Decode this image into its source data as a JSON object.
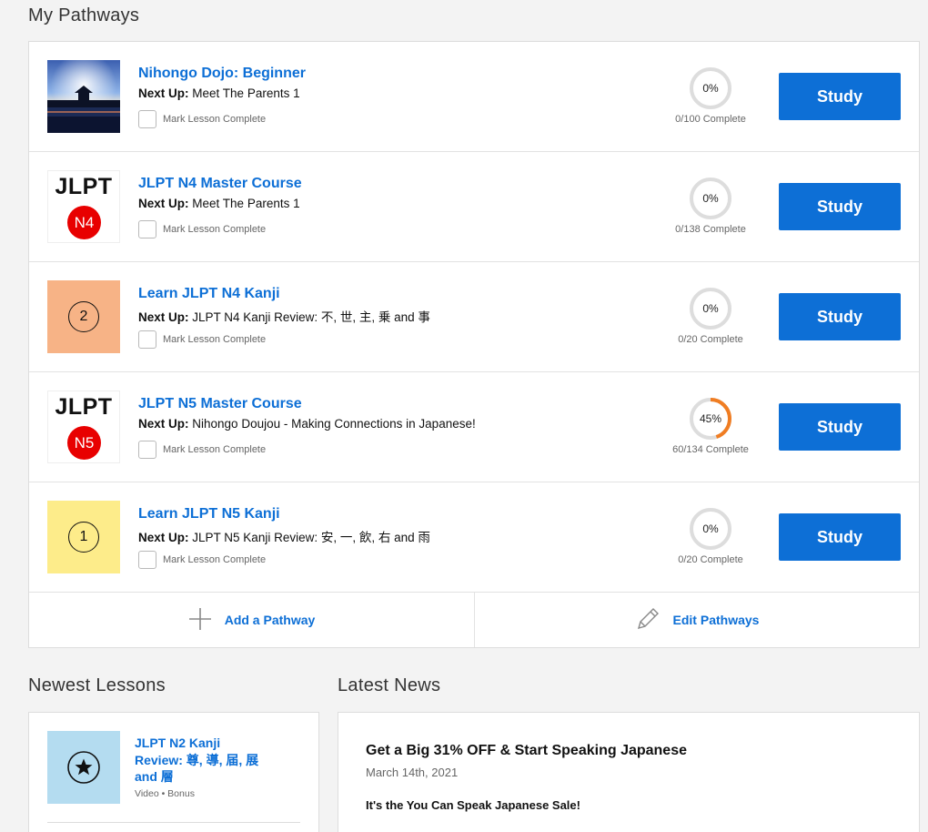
{
  "sections": {
    "pathways_title": "My Pathways",
    "newest_lessons_title": "Newest Lessons",
    "latest_news_title": "Latest News"
  },
  "colors": {
    "accent": "#0d6fd6",
    "progress_track": "#dddddd",
    "progress_fill": "#f07d22",
    "n4_kanji_tile": "#f7b386",
    "n5_kanji_tile": "#fdec8a",
    "lesson_tile": "#b4dcf0",
    "jlpt_badge": "#e80000"
  },
  "pathways": [
    {
      "title": "Nihongo Dojo: Beginner",
      "next_label": "Next Up:",
      "next": "Meet The Parents 1",
      "mark_label": "Mark Lesson Complete",
      "percent_text": "0%",
      "progress": 0,
      "complete_text": "0/100 Complete",
      "button": "Study",
      "thumb": "photo-pagoda-lake"
    },
    {
      "title": "JLPT N4 Master Course",
      "next_label": "Next Up:",
      "next": "Meet The Parents 1",
      "mark_label": "Mark Lesson Complete",
      "percent_text": "0%",
      "progress": 0,
      "complete_text": "0/138 Complete",
      "button": "Study",
      "thumb_text": "JLPT",
      "thumb_badge": "N4"
    },
    {
      "title": "Learn JLPT N4 Kanji",
      "next_label": "Next Up:",
      "next": "JLPT N4 Kanji Review: 不, 世, 主, 乗 and 事",
      "mark_label": "Mark Lesson Complete",
      "percent_text": "0%",
      "progress": 0,
      "complete_text": "0/20 Complete",
      "button": "Study",
      "thumb_number": "2"
    },
    {
      "title": "JLPT N5 Master Course",
      "next_label": "Next Up:",
      "next": "Nihongo Doujou - Making Connections in Japanese!",
      "mark_label": "Mark Lesson Complete",
      "percent_text": "45%",
      "progress": 0.45,
      "complete_text": "60/134 Complete",
      "button": "Study",
      "thumb_text": "JLPT",
      "thumb_badge": "N5"
    },
    {
      "title": "Learn JLPT N5 Kanji",
      "next_label": "Next Up:",
      "next": "JLPT N5 Kanji Review: 安, 一, 飲, 右 and 雨",
      "mark_label": "Mark Lesson Complete",
      "percent_text": "0%",
      "progress": 0,
      "complete_text": "0/20 Complete",
      "button": "Study",
      "thumb_number": "1"
    }
  ],
  "actions": {
    "add": "Add a Pathway",
    "edit": "Edit Pathways"
  },
  "newest_lesson": {
    "title": "JLPT N2 Kanji Review: 尊, 導, 届, 展 and 層",
    "meta": "Video • Bonus",
    "icon": "star-icon"
  },
  "news": {
    "title": "Get a Big 31% OFF & Start Speaking Japanese",
    "date": "March 14th, 2021",
    "body": "It's the You Can Speak Japanese Sale!"
  }
}
